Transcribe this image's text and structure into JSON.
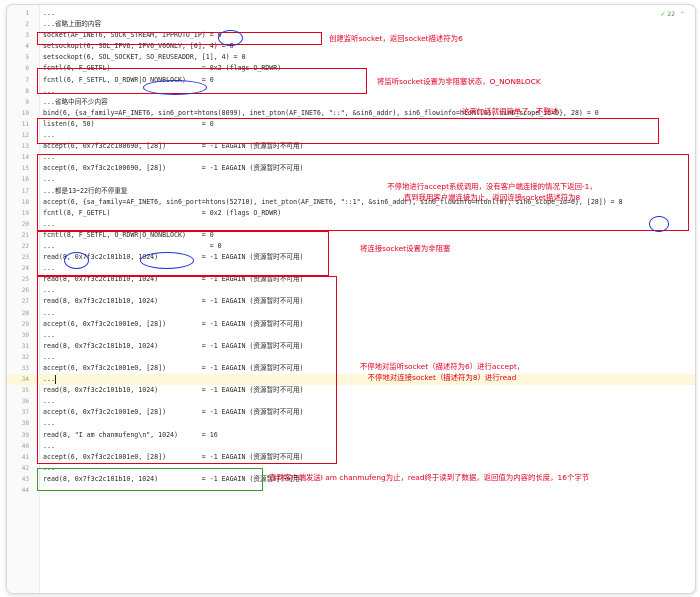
{
  "editor": {
    "badge_count": "22",
    "lines": [
      {
        "num": "1",
        "text": "..."
      },
      {
        "num": "2",
        "text": "...省略上面的内容"
      },
      {
        "num": "3",
        "text": "socket(AF_INET6, SOCK_STREAM, IPPROTO_IP) = 6"
      },
      {
        "num": "4",
        "text": "setsockopt(6, SOL_IPV6, IPV6_V6ONLY, [0], 4) = 0"
      },
      {
        "num": "5",
        "text": "setsockopt(6, SOL_SOCKET, SO_REUSEADDR, [1], 4) = 0"
      },
      {
        "num": "6",
        "text": "fcntl(6, F_GETFL)                       = 0x2 (flags O_RDWR)"
      },
      {
        "num": "7",
        "text": "fcntl(6, F_SETFL, O_RDWR|O_NONBLOCK)    = 0"
      },
      {
        "num": "8",
        "text": "..."
      },
      {
        "num": "9",
        "text": "...省略中间不少内容"
      },
      {
        "num": "10",
        "text": "bind(6, {sa_family=AF_INET6, sin6_port=htons(8099), inet_pton(AF_INET6, \"::\", &sin6_addr), sin6_flowinfo=htonl(0), sin6_scope_id=0}, 28) = 0"
      },
      {
        "num": "11",
        "text": "listen(6, 50)                           = 0"
      },
      {
        "num": "12",
        "text": "..."
      },
      {
        "num": "13",
        "text": "accept(6, 0x7f3c2c100690, [28])         = -1 EAGAIN (资源暂时不可用)"
      },
      {
        "num": "14",
        "text": "..."
      },
      {
        "num": "15",
        "text": "accept(6, 0x7f3c2c100690, [28])         = -1 EAGAIN (资源暂时不可用)"
      },
      {
        "num": "16",
        "text": "..."
      },
      {
        "num": "17",
        "text": "...都是13~22行的不停重复"
      },
      {
        "num": "18",
        "text": "accept(6, {sa_family=AF_INET6, sin6_port=htons(52710), inet_pton(AF_INET6, \"::1\", &sin6_addr), sin6_flowinfo=htonl(0), sin6_scope_id=0}, [28]) = 8"
      },
      {
        "num": "19",
        "text": "fcntl(8, F_GETFL)                       = 0x2 (flags O_RDWR)"
      },
      {
        "num": "20",
        "text": "..."
      },
      {
        "num": "21",
        "text": "fcntl(8, F_SETFL, O_RDWR|O_NONBLOCK)    = 0"
      },
      {
        "num": "22",
        "text": "...                                       = 0"
      },
      {
        "num": "23",
        "text": "read(8, 0x7f3c2c101b10, 1024)           = -1 EAGAIN (资源暂时不可用)"
      },
      {
        "num": "24",
        "text": "..."
      },
      {
        "num": "25",
        "text": "read(8, 0x7f3c2c101b10, 1024)           = -1 EAGAIN (资源暂时不可用)"
      },
      {
        "num": "26",
        "text": "..."
      },
      {
        "num": "27",
        "text": "read(8, 0x7f3c2c101b10, 1024)           = -1 EAGAIN (资源暂时不可用)"
      },
      {
        "num": "28",
        "text": "..."
      },
      {
        "num": "29",
        "text": "accept(6, 0x7f3c2c1001e0, [28])         = -1 EAGAIN (资源暂时不可用)"
      },
      {
        "num": "30",
        "text": "..."
      },
      {
        "num": "31",
        "text": "read(8, 0x7f3c2c101b10, 1024)           = -1 EAGAIN (资源暂时不可用)"
      },
      {
        "num": "32",
        "text": "..."
      },
      {
        "num": "33",
        "text": "accept(6, 0x7f3c2c1001e0, [28])         = -1 EAGAIN (资源暂时不可用)"
      },
      {
        "num": "34",
        "text": "..."
      },
      {
        "num": "35",
        "text": "read(8, 0x7f3c2c101b10, 1024)           = -1 EAGAIN (资源暂时不可用)"
      },
      {
        "num": "36",
        "text": "..."
      },
      {
        "num": "37",
        "text": "accept(6, 0x7f3c2c1001e0, [28])         = -1 EAGAIN (资源暂时不可用)"
      },
      {
        "num": "38",
        "text": "..."
      },
      {
        "num": "39",
        "text": "read(8, \"I am chanmufeng\\n\", 1024)      = 16"
      },
      {
        "num": "40",
        "text": "..."
      },
      {
        "num": "41",
        "text": "accept(6, 0x7f3c2c1001e0, [28])         = -1 EAGAIN (资源暂时不可用)"
      },
      {
        "num": "42",
        "text": "..."
      },
      {
        "num": "43",
        "text": "read(8, 0x7f3c2c101b10, 1024)           = -1 EAGAIN (资源暂时不可用)"
      },
      {
        "num": "44",
        "text": ""
      }
    ]
  },
  "annotations": {
    "a1": "创建监听socket，返回socket描述符为6",
    "a2": "将监听socket设置为非阻塞状态，O_NONBLOCK",
    "a3": "这两句话就很简单了，不赘述",
    "a4_1": "不停地进行accept系统调用，没有客户端连接的情况下返回-1，",
    "a4_2": "直到我用客户端连接为止，返回连接socket描述符为8",
    "a5": "将连接socket设置为非阻塞",
    "a6_1": "不停地对监听socket（描述符为6）进行accept，",
    "a6_2": "不停地对连接socket（描述符为8）进行read",
    "a7": "直到客户端发送I am chanmufeng为止，read终于读到了数据，返回值为内容的长度，16个字节"
  },
  "colors": {
    "annotation_red": "#e00020",
    "oval_blue": "#2233dd",
    "box_green": "#3f9a2a",
    "highlight_line": "#fdf8d9"
  }
}
